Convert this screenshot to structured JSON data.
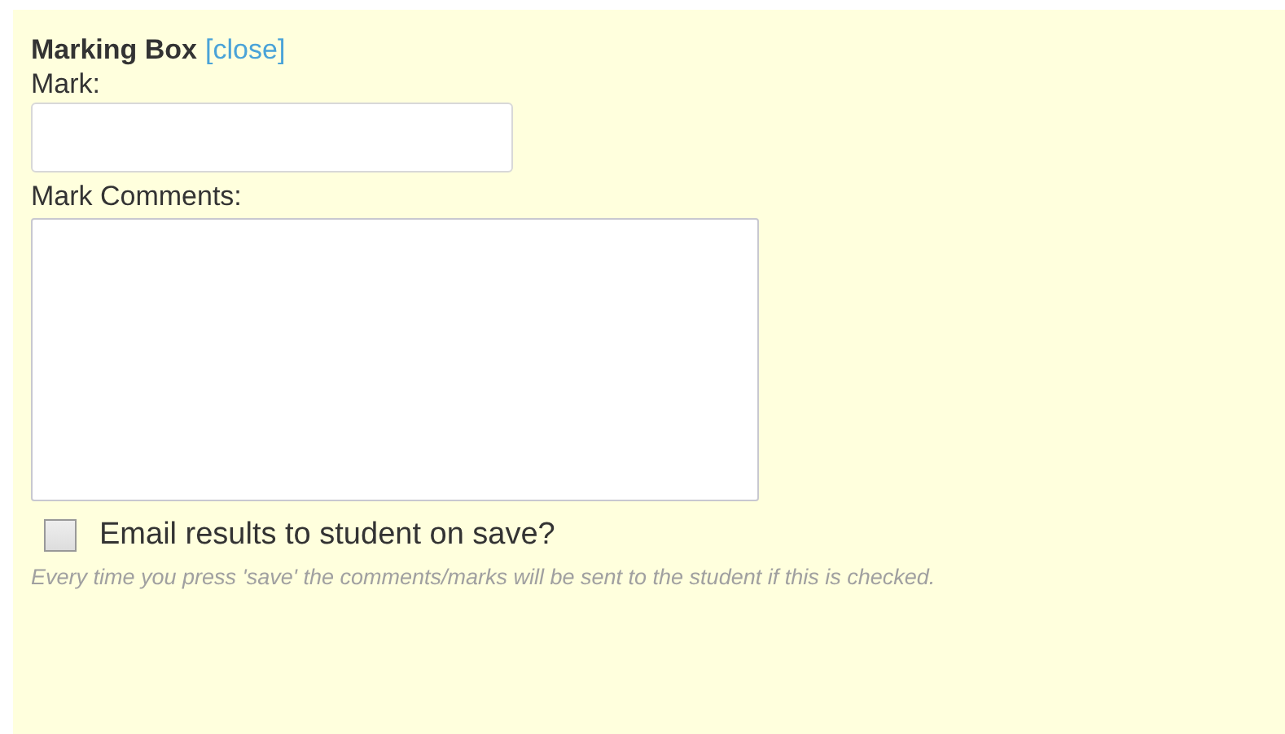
{
  "title": "Marking Box",
  "close_link": "[close]",
  "mark": {
    "label": "Mark:"
  },
  "comments": {
    "label": "Mark Comments:"
  },
  "email_option": {
    "label": "Email results to student on save?",
    "checked": false
  },
  "hint": "Every time you press 'save' the comments/marks will be sent to the student if this is checked."
}
